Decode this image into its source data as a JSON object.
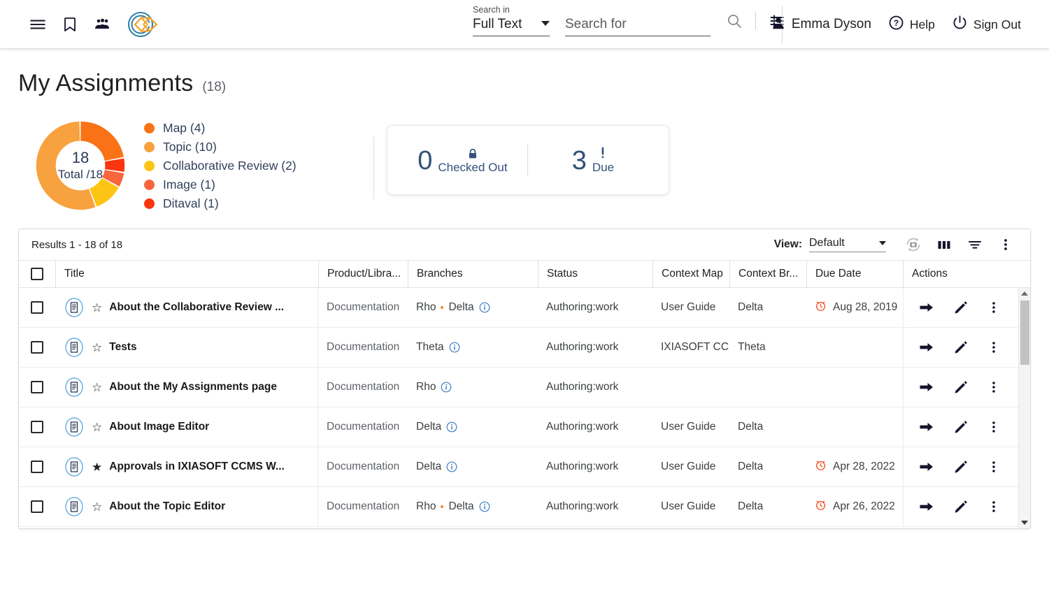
{
  "header": {
    "icons": {
      "menu": "hamburger-menu-icon",
      "bookmark": "bookmark-icon",
      "people": "people-icon",
      "logo": "ixiasoft-logo-icon"
    },
    "search": {
      "search_in_label": "Search in",
      "search_in_value": "Full Text",
      "search_for_placeholder": "Search for",
      "search_for_value": "",
      "search_icon": "search-icon",
      "filter_icon": "filter-sliders-icon"
    },
    "user_name": "Emma Dyson",
    "help_label": "Help",
    "sign_out_label": "Sign Out"
  },
  "page": {
    "title": "My Assignments",
    "count": "(18)"
  },
  "chart_data": {
    "type": "pie",
    "title": "My Assignments",
    "total": "18",
    "total_sublabel": "Total /18",
    "categories": [
      "Map",
      "Topic",
      "Collaborative Review",
      "Image",
      "Ditaval"
    ],
    "values": [
      4,
      10,
      2,
      1,
      1
    ],
    "colors": [
      "#f97316",
      "#f8a13f",
      "#fdc513",
      "#f9653c",
      "#f9350f"
    ],
    "legend": [
      {
        "label": "Map (4)",
        "color": "#f97316",
        "value": 4
      },
      {
        "label": "Topic (10)",
        "color": "#f8a13f",
        "value": 10
      },
      {
        "label": "Collaborative Review (2)",
        "color": "#fdc513",
        "value": 2
      },
      {
        "label": "Image (1)",
        "color": "#f9653c",
        "value": 1
      },
      {
        "label": "Ditaval (1)",
        "color": "#f9350f",
        "value": 1
      }
    ],
    "legend_position": "right",
    "grid": false
  },
  "stats": {
    "checked_out": {
      "number": "0",
      "label": "Checked Out",
      "icon": "lock-icon"
    },
    "due": {
      "number": "3",
      "label": "Due",
      "icon": "exclamation-icon"
    }
  },
  "results": {
    "count_text": "Results 1 - 18 of 18",
    "view_label": "View:",
    "view_value": "Default",
    "toolbar_icons": {
      "refresh": "refresh-camera-icon",
      "columns": "columns-icon",
      "filter": "filter-icon",
      "more": "more-vertical-icon"
    },
    "columns": [
      "Title",
      "Product/Libra...",
      "Branches",
      "Status",
      "Context Map",
      "Context Br...",
      "Due Date",
      "Actions"
    ],
    "rows": [
      {
        "doc_icon": "document-icon",
        "starred": false,
        "title": "About the Collaborative Review ...",
        "product": "Documentation",
        "branches": [
          "Rho",
          "Delta"
        ],
        "info_icon": "info-icon",
        "status": "Authoring:work",
        "context_map": "User Guide",
        "context_branch": "Delta",
        "due_date": "Aug 28, 2019",
        "due_icon": "alarm-clock-icon"
      },
      {
        "doc_icon": "document-icon",
        "starred": false,
        "title": "Tests",
        "product": "Documentation",
        "branches": [
          "Theta"
        ],
        "info_icon": "info-icon",
        "status": "Authoring:work",
        "context_map": "IXIASOFT CC",
        "context_branch": "Theta",
        "due_date": "",
        "due_icon": ""
      },
      {
        "doc_icon": "document-icon",
        "starred": false,
        "title": "About the My Assignments page",
        "product": "Documentation",
        "branches": [
          "Rho"
        ],
        "info_icon": "info-icon",
        "status": "Authoring:work",
        "context_map": "",
        "context_branch": "",
        "due_date": "",
        "due_icon": ""
      },
      {
        "doc_icon": "document-icon",
        "starred": false,
        "title": "About Image Editor",
        "product": "Documentation",
        "branches": [
          "Delta"
        ],
        "info_icon": "info-icon",
        "status": "Authoring:work",
        "context_map": "User Guide",
        "context_branch": "Delta",
        "due_date": "",
        "due_icon": ""
      },
      {
        "doc_icon": "document-icon",
        "starred": true,
        "title": "Approvals in IXIASOFT CCMS W...",
        "product": "Documentation",
        "branches": [
          "Delta"
        ],
        "info_icon": "info-icon",
        "status": "Authoring:work",
        "context_map": "User Guide",
        "context_branch": "Delta",
        "due_date": "Apr 28, 2022",
        "due_icon": "alarm-clock-icon"
      },
      {
        "doc_icon": "document-icon",
        "starred": false,
        "title": "About the Topic Editor",
        "product": "Documentation",
        "branches": [
          "Rho",
          "Delta"
        ],
        "info_icon": "info-icon",
        "status": "Authoring:work",
        "context_map": "User Guide",
        "context_branch": "Delta",
        "due_date": "Apr 26, 2022",
        "due_icon": "alarm-clock-icon"
      }
    ],
    "row_actions": {
      "open": "arrow-right-icon",
      "edit": "pencil-icon",
      "more": "more-vertical-icon"
    }
  },
  "colors": {
    "accent_orange": "#f08a2e",
    "due_red": "#f4511e",
    "doc_blue": "#5aa7dd",
    "stat_blue": "#33507a"
  }
}
